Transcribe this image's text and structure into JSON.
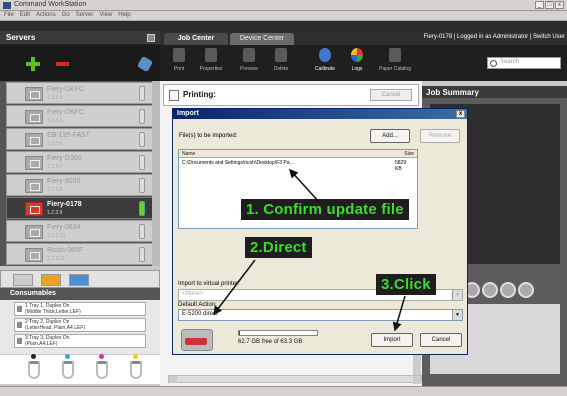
{
  "window": {
    "title": "Command WorkStation",
    "controls": [
      "_",
      "□",
      "x"
    ]
  },
  "menu": [
    "File",
    "Edit",
    "Actions",
    "Go",
    "Server",
    "View",
    "Help"
  ],
  "servers_panel": {
    "title": "Servers",
    "items": [
      {
        "name": "Fiery-DKFC",
        "ip": "1.2.3.4",
        "active": false
      },
      {
        "name": "Fiery-DKFC",
        "ip": "1.2.3.5",
        "active": false
      },
      {
        "name": "EB-135-FA97",
        "ip": "1.2.3.6",
        "active": false
      },
      {
        "name": "Fiery-D300",
        "ip": "1.2.3.7",
        "active": false
      },
      {
        "name": "Fiery-8000",
        "ip": "1.2.3.8",
        "active": false
      },
      {
        "name": "Fiery-0178",
        "ip": "1.2.3.9",
        "active": true
      },
      {
        "name": "Fiery-0634",
        "ip": "1.2.3.10",
        "active": false
      },
      {
        "name": "Ricoh-065F",
        "ip": "1.2.3.11",
        "active": false
      }
    ]
  },
  "consumables": {
    "title": "Consumables",
    "trays": [
      {
        "line1": "1 Tray 1, Duplex On",
        "line2": "(Middle Thick,Letter,LEF)"
      },
      {
        "line1": "2 Tray 2, Duplex On",
        "line2": "(LetterHead, Plain,A4,LEF)"
      },
      {
        "line1": "3 Tray 3, Duplex On",
        "line2": "(Plain,A4,LEF)"
      }
    ],
    "toner_colors": [
      "#222222",
      "#2aa8d8",
      "#d630a8",
      "#e6d21a"
    ]
  },
  "tabs": [
    "Job Center",
    "Device Center"
  ],
  "login_status": "Fiery-0178 | Logged in as Administrator | Switch User",
  "toolbar": {
    "buttons": [
      "Print",
      "Properties",
      "Preview",
      "Delete",
      "Calibrate",
      "Logs",
      "Paper Catalog"
    ],
    "search_placeholder": "Search"
  },
  "printing": {
    "label": "Printing:",
    "cancel": "Cancel"
  },
  "job_summary": {
    "title": "Job Summary"
  },
  "dialog": {
    "title": "Import",
    "files_label": "File(s) to be imported:",
    "add": "Add...",
    "remove": "Remove",
    "col_name": "Name",
    "col_size": "Size",
    "file_name": "C:\\Documents and Settings\\ricoh\\Desktop\\F3 Pa...",
    "file_size": "5829 KB",
    "virtual_printer_label": "Import to virtual printer:",
    "virtual_printer_value": "<None>",
    "default_action_label": "Default Action:",
    "default_action_value": "E-5200 direct",
    "free_space": "62.7 GB free of 63.3 GB",
    "disk_used_fraction": 0.01,
    "import": "Import",
    "cancel": "Cancel"
  },
  "annotations": {
    "step1": "1. Confirm update file",
    "step2": "2.Direct",
    "step3": "3.Click"
  }
}
